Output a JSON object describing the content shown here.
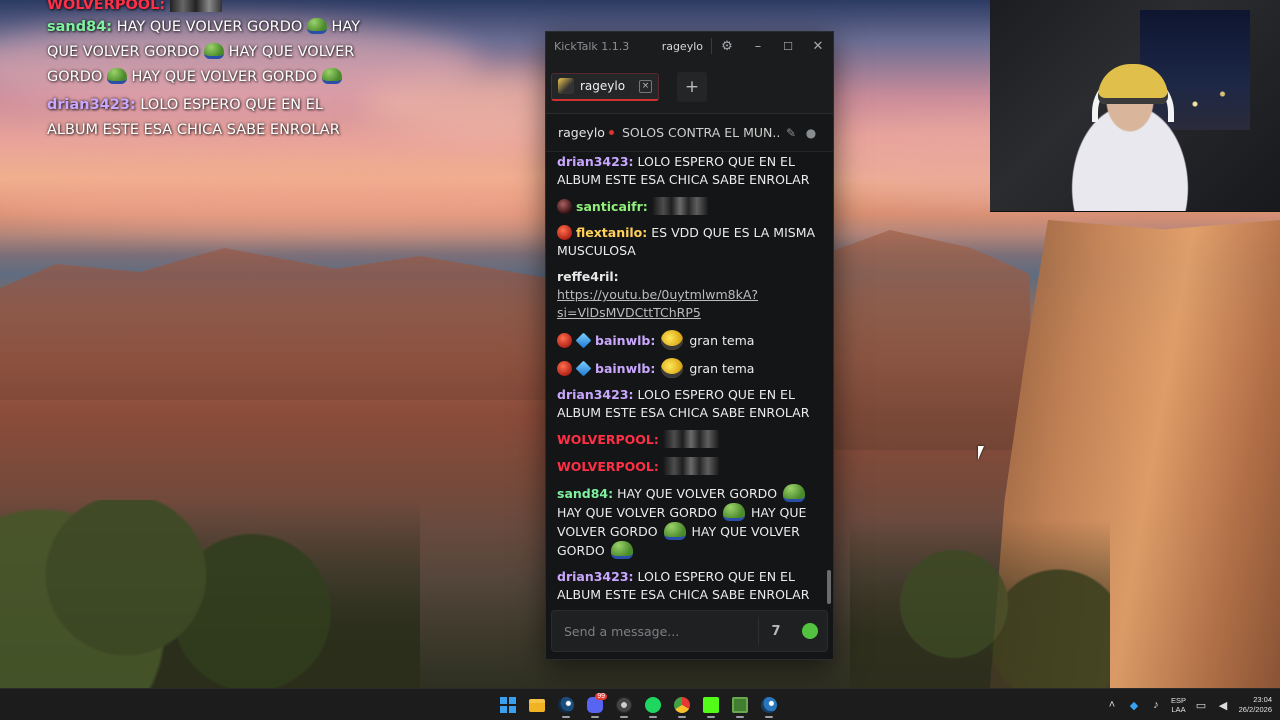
{
  "overlay_chat": {
    "top_user": "WOLVERPOOL:",
    "messages": [
      {
        "user": "sand84:",
        "color": "#7ef0a0",
        "text": "HAY QUE VOLVER GORDO",
        "repeat": 4,
        "pepe": true
      },
      {
        "user": "drian3423:",
        "color": "#c9a7ff",
        "text": "LOLO ESPERO QUE EN EL ALBUM ESTE ESA CHICA SABE ENROLAR"
      }
    ]
  },
  "kicktalk": {
    "app_title": "KickTalk 1.1.3",
    "title_user": "rageylo",
    "tab": {
      "label": "rageylo",
      "close": "×"
    },
    "add_tab": "+",
    "channel": "rageylo",
    "stream_title": "SOLOS CONTRA EL MUN...",
    "input_placeholder": "Send a message...",
    "seven_tv": "7",
    "messages": [
      {
        "user": "drian3423:",
        "color": "#c9a7ff",
        "text": "LOLO ESPERO QUE EN EL ALBUM ESTE ESA CHICA SABE ENROLAR"
      },
      {
        "user": "santicaifr:",
        "color": "#8ff07a",
        "badge": "dark",
        "emote": "blur"
      },
      {
        "user": "flextanilo:",
        "color": "#ffd15a",
        "badge": "round",
        "text": "ES VDD QUE ES LA MISMA MUSCULOSA"
      },
      {
        "user": "reffe4ril:",
        "color": "#e7e7e7",
        "link": "https://youtu.be/0uytmlwm8kA?si=VlDsMVDCttTChRP5"
      },
      {
        "user": "bainwlb:",
        "color": "#c9a7ff",
        "badge": "round",
        "cube": true,
        "text": "gran tema"
      },
      {
        "user": "bainwlb:",
        "color": "#c9a7ff",
        "badge": "round",
        "cube": true,
        "text": "gran tema"
      },
      {
        "user": "drian3423:",
        "color": "#c9a7ff",
        "text": "LOLO ESPERO QUE EN EL ALBUM ESTE ESA CHICA SABE ENROLAR"
      },
      {
        "user": "WOLVERPOOL:",
        "color": "#ff2f45",
        "emote": "blur"
      },
      {
        "user": "WOLVERPOOL:",
        "color": "#ff2f45",
        "emote": "blur"
      },
      {
        "user": "sand84:",
        "color": "#7ef0a0",
        "text": "HAY QUE VOLVER GORDO",
        "repeat": 4,
        "pepe": true
      },
      {
        "user": "drian3423:",
        "color": "#c9a7ff",
        "text": "LOLO ESPERO QUE EN EL ALBUM ESTE ESA CHICA SABE ENROLAR"
      }
    ]
  },
  "taskbar": {
    "apps": [
      {
        "name": "start-button",
        "icon": "windows-icon"
      },
      {
        "name": "file-explorer",
        "icon": "folder-icon"
      },
      {
        "name": "steam",
        "icon": "steam-icon"
      },
      {
        "name": "discord",
        "icon": "discord-icon",
        "badge": "99"
      },
      {
        "name": "app-circle",
        "icon": "app-circle-icon"
      },
      {
        "name": "spotify",
        "icon": "spotify-icon"
      },
      {
        "name": "chrome",
        "icon": "chrome-icon"
      },
      {
        "name": "kick",
        "icon": "kick-icon"
      },
      {
        "name": "green-app",
        "icon": "green-app-icon"
      },
      {
        "name": "steam-2",
        "icon": "steam-icon"
      }
    ],
    "lang_top": "ESP",
    "lang_bottom": "LAA",
    "time": "23:04",
    "date": "26/2/2026"
  }
}
